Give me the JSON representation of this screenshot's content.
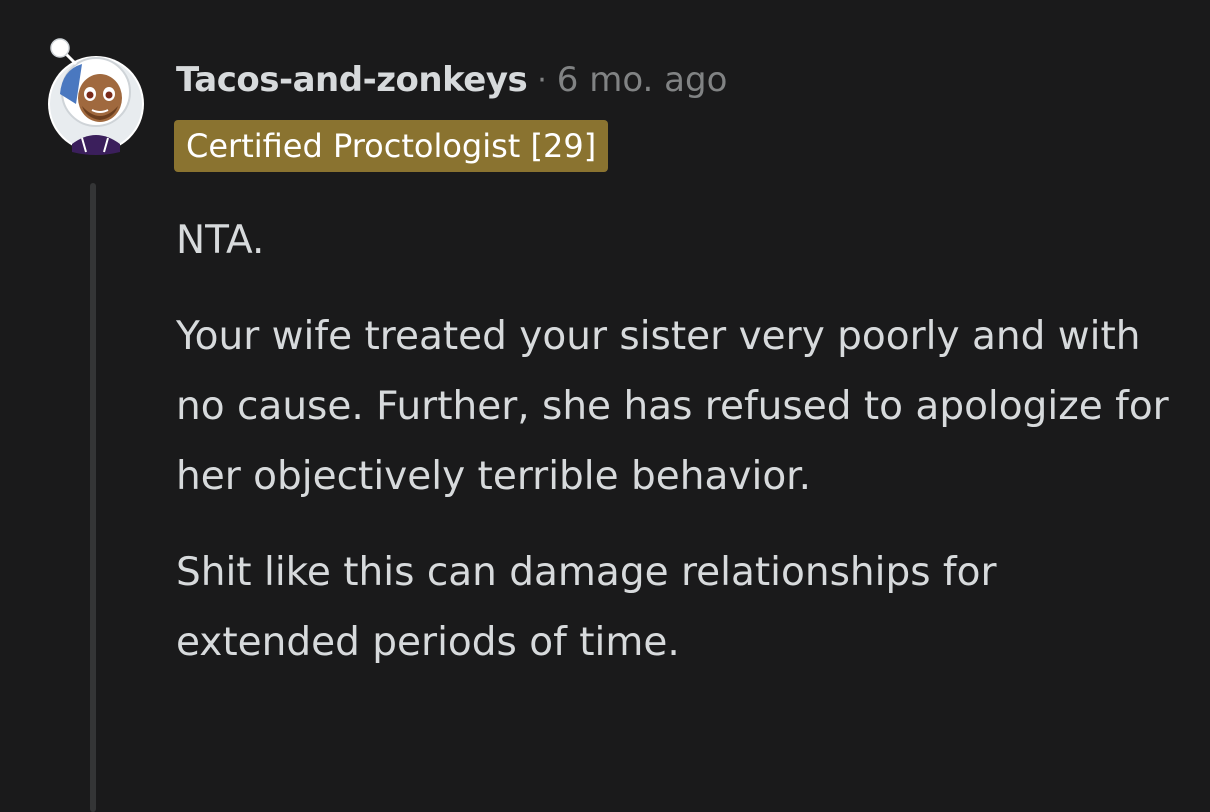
{
  "comment": {
    "author": "Tacos-and-zonkeys",
    "separator": "·",
    "timestamp": "6 mo. ago",
    "flair": "Certified Proctologist [29]",
    "paragraphs": [
      "NTA.",
      "Your wife treated your sister very poorly and with no cause. Further, she has refused to apologize for her objectively terrible behavior.",
      "Shit like this can damage relationships for extended periods of time."
    ]
  },
  "colors": {
    "background": "#1a1a1b",
    "text": "#d7dadc",
    "meta": "#818384",
    "flair_bg": "#8a7330",
    "thread_line": "#343536"
  },
  "icons": {
    "avatar": "snoo-avatar-icon"
  }
}
